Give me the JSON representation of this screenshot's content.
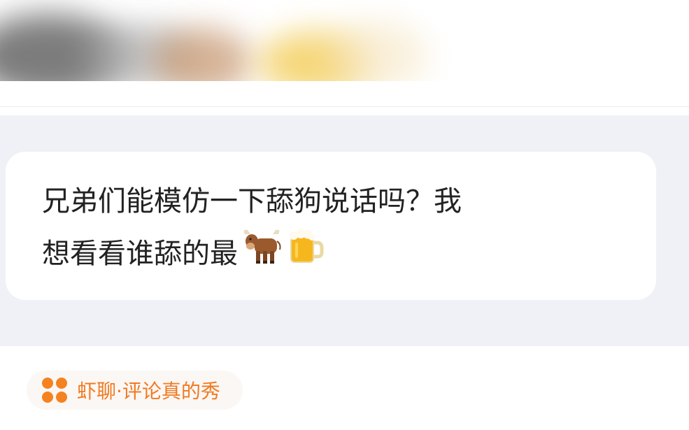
{
  "post": {
    "question_line_1": "兄弟们能模仿一下舔狗说话吗？我",
    "question_line_2": "想看看谁舔的最",
    "emojis": [
      "ox-emoji",
      "beer-mug-emoji"
    ]
  },
  "source": {
    "label": "虾聊·评论真的秀",
    "icon": "four-dots-icon"
  },
  "colors": {
    "quote_background": "#eff1f7",
    "card_background": "#ffffff",
    "text": "#222222",
    "accent": "#f07a22",
    "icon_dot": "#f58220"
  }
}
